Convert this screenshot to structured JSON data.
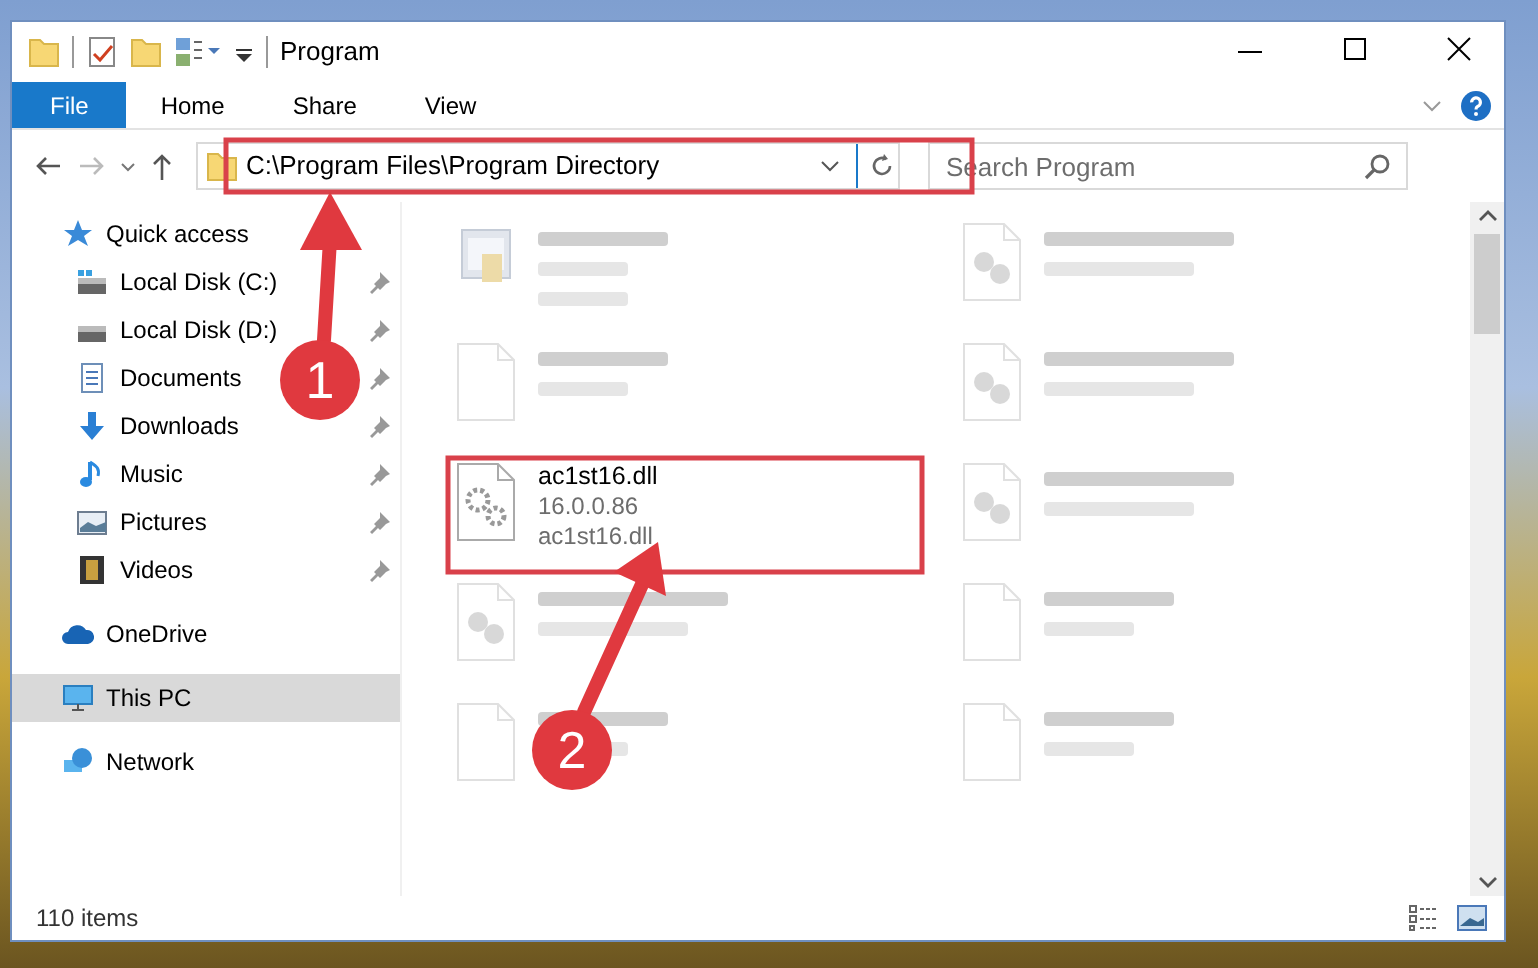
{
  "window": {
    "title": "Program"
  },
  "ribbon": {
    "tabs": [
      {
        "label": "File",
        "kind": "menu"
      },
      {
        "label": "Home",
        "kind": "tab"
      },
      {
        "label": "Share",
        "kind": "tab"
      },
      {
        "label": "View",
        "kind": "tab"
      }
    ]
  },
  "address": {
    "path": "C:\\Program Files\\Program Directory"
  },
  "search": {
    "placeholder": "Search Program"
  },
  "sidebar": {
    "items": [
      {
        "label": "Quick access",
        "kind": "star",
        "selected": false,
        "children": [
          {
            "label": "Local Disk (C:)",
            "kind": "drive-c",
            "selected": false,
            "pinned": true
          },
          {
            "label": "Local Disk (D:)",
            "kind": "drive",
            "selected": false,
            "pinned": true
          },
          {
            "label": "Documents",
            "kind": "documents",
            "selected": false,
            "pinned": true
          },
          {
            "label": "Downloads",
            "kind": "downloads",
            "selected": false,
            "pinned": true
          },
          {
            "label": "Music",
            "kind": "music",
            "selected": false,
            "pinned": true
          },
          {
            "label": "Pictures",
            "kind": "pictures",
            "selected": false,
            "pinned": true
          },
          {
            "label": "Videos",
            "kind": "videos",
            "selected": false,
            "pinned": true
          }
        ]
      },
      {
        "label": "OneDrive",
        "kind": "cloud",
        "selected": false
      },
      {
        "label": "This PC",
        "kind": "pc",
        "selected": true
      },
      {
        "label": "Network",
        "kind": "network",
        "selected": false
      }
    ]
  },
  "files": [
    {
      "kind": "exe",
      "blurred": true
    },
    {
      "kind": "blank",
      "blurred": true
    },
    {
      "name": "ac1st16.dll",
      "details": [
        "16.0.0.86",
        "ac1st16.dll"
      ],
      "kind": "gear",
      "blurred": false
    },
    {
      "kind": "resource",
      "blurred": true
    },
    {
      "kind": "blank",
      "blurred": true
    },
    {
      "kind": "resource",
      "blurred": true
    },
    {
      "kind": "resource",
      "blurred": true
    },
    {
      "kind": "resource",
      "blurred": true
    },
    {
      "kind": "blank",
      "blurred": true
    },
    {
      "kind": "blank",
      "blurred": true
    }
  ],
  "status_bar": {
    "count": "110 items"
  },
  "annotations": [
    {
      "number": "1"
    },
    {
      "number": "2"
    }
  ]
}
